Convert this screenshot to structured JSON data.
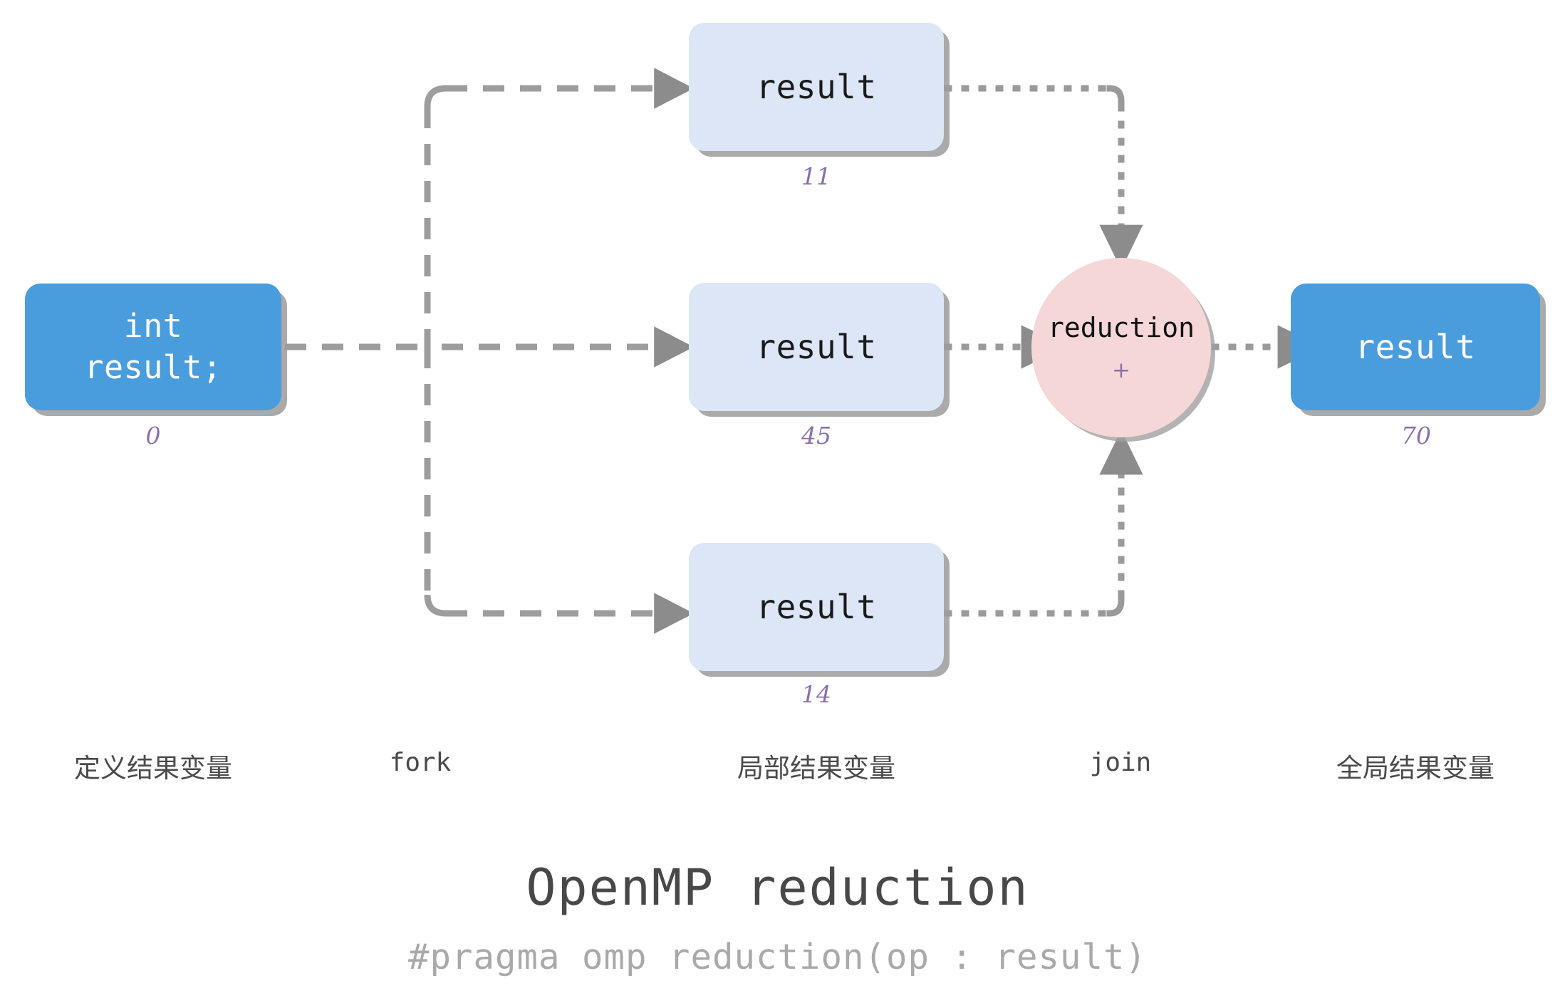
{
  "diagram": {
    "title": "OpenMP reduction",
    "subtitle": "#pragma omp reduction(op : result)",
    "colors": {
      "global_box": "#4a9ddd",
      "local_box": "#dde6f7",
      "reduction_circle": "#f5d7d7",
      "value_text": "#8a6fae",
      "wire": "#9a9a9a",
      "title_text": "#484848",
      "subtitle_text": "#a9a9a9"
    },
    "define_node": {
      "text": "int\nresult;",
      "value": "0"
    },
    "local_nodes": [
      {
        "text": "result",
        "value": "11"
      },
      {
        "text": "result",
        "value": "45"
      },
      {
        "text": "result",
        "value": "14"
      }
    ],
    "reduction_node": {
      "text": "reduction",
      "operator": "+"
    },
    "global_node": {
      "text": "result",
      "value": "70"
    },
    "stage_labels": [
      {
        "text": "定义结果变量",
        "style": "cjk"
      },
      {
        "text": "fork",
        "style": "mono"
      },
      {
        "text": "局部结果变量",
        "style": "cjk"
      },
      {
        "text": "join",
        "style": "mono"
      },
      {
        "text": "全局结果变量",
        "style": "cjk"
      }
    ]
  }
}
